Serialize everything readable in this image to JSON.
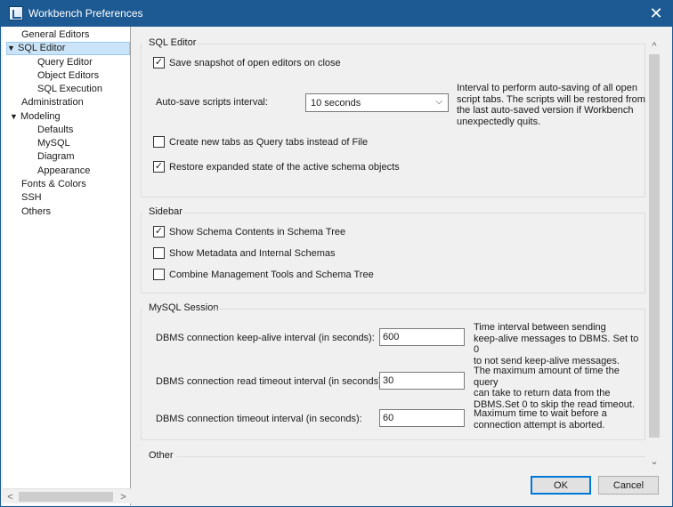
{
  "window": {
    "title": "Workbench Preferences",
    "close_label": "✕"
  },
  "sidebar": {
    "items": [
      {
        "label": "General Editors"
      },
      {
        "label": "SQL Editor",
        "expanded": true,
        "selected": true
      },
      {
        "label": "Query Editor"
      },
      {
        "label": "Object Editors"
      },
      {
        "label": "SQL Execution"
      },
      {
        "label": "Administration"
      },
      {
        "label": "Modeling",
        "expanded": true
      },
      {
        "label": "Defaults"
      },
      {
        "label": "MySQL"
      },
      {
        "label": "Diagram"
      },
      {
        "label": "Appearance"
      },
      {
        "label": "Fonts & Colors"
      },
      {
        "label": "SSH"
      },
      {
        "label": "Others"
      }
    ]
  },
  "sql_editor": {
    "title": "SQL Editor",
    "save_snapshot": {
      "label": "Save snapshot of open editors on close",
      "checked": true
    },
    "autosave": {
      "label": "Auto-save scripts interval:",
      "value": "10 seconds",
      "desc_lines": [
        "Interval to perform auto-saving of all open",
        "script tabs. The scripts will be restored from",
        "the last auto-saved version if Workbench",
        "unexpectedly quits."
      ]
    },
    "new_tabs": {
      "label": "Create new tabs as Query tabs instead of File",
      "checked": false
    },
    "restore_schema": {
      "label": "Restore expanded state of the active schema objects",
      "checked": true
    }
  },
  "sidebar_section": {
    "title": "Sidebar",
    "show_schema": {
      "label": "Show Schema Contents in Schema Tree",
      "checked": true
    },
    "show_metadata": {
      "label": "Show Metadata and Internal Schemas",
      "checked": false
    },
    "combine_tools": {
      "label": "Combine Management Tools and Schema Tree",
      "checked": false
    }
  },
  "mysql_session": {
    "title": "MySQL Session",
    "keepalive": {
      "label": "DBMS connection keep-alive interval (in seconds):",
      "value": "600",
      "desc_lines": [
        "Time interval between sending",
        "keep-alive messages to DBMS. Set to 0",
        "to not send keep-alive messages."
      ]
    },
    "read_timeout": {
      "label": "DBMS connection read timeout interval (in seconds):",
      "value": "30",
      "desc_lines": [
        "The maximum amount of time the query",
        "can take to return data from the",
        "DBMS.Set 0 to skip the read timeout."
      ]
    },
    "conn_timeout": {
      "label": "DBMS connection timeout interval (in seconds):",
      "value": "60",
      "desc_lines": [
        "Maximum time to wait before a",
        "connection attempt is aborted."
      ]
    }
  },
  "other_section": {
    "title": "Other"
  },
  "buttons": {
    "ok": "OK",
    "cancel": "Cancel"
  },
  "glyphs": {
    "check": "✓",
    "expanded": "▼",
    "chevron_down": "⌵",
    "arrow_left": "<",
    "arrow_right": ">",
    "arrow_up": "^",
    "arrow_down": "⌄"
  }
}
